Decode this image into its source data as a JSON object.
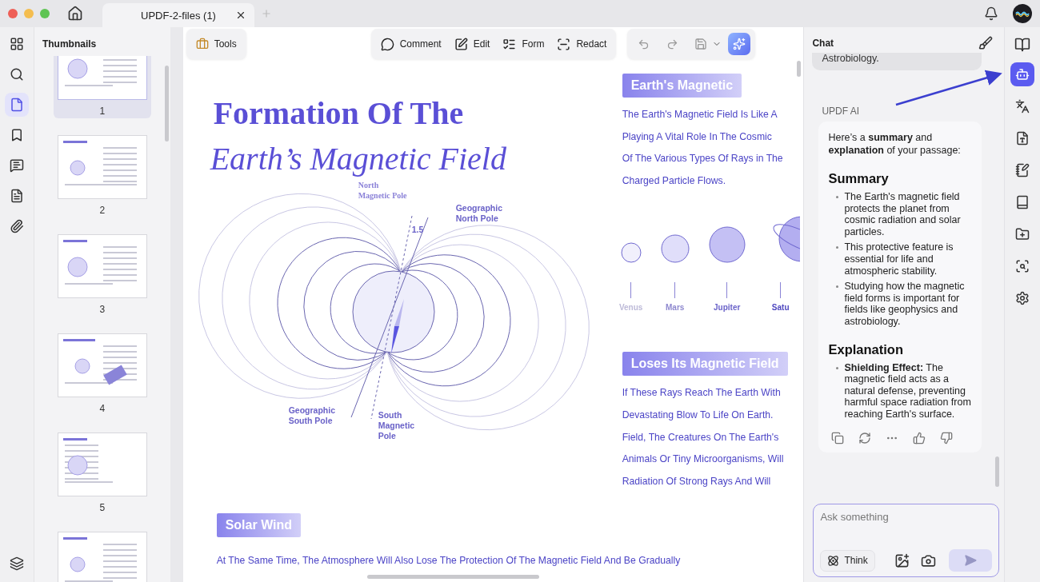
{
  "window": {
    "tab_title": "UPDF-2-files (1)"
  },
  "left_rail": [
    {
      "kind": "grid",
      "selected": false
    },
    {
      "kind": "search",
      "selected": false
    },
    {
      "kind": "page",
      "selected": true
    },
    {
      "kind": "bookmark",
      "selected": false
    },
    {
      "kind": "comment",
      "selected": false
    },
    {
      "kind": "form",
      "selected": false
    },
    {
      "kind": "attachment",
      "selected": false
    },
    {
      "kind": "layers",
      "selected": false
    }
  ],
  "thumbnails": {
    "title": "Thumbnails",
    "pages": [
      {
        "label": "1",
        "selected": true
      },
      {
        "label": "2",
        "selected": false
      },
      {
        "label": "3",
        "selected": false
      },
      {
        "label": "4",
        "selected": false
      },
      {
        "label": "5",
        "selected": false
      },
      {
        "selected": false
      }
    ]
  },
  "toolbar": {
    "tools": "Tools",
    "items": [
      {
        "kind": "comment",
        "label": "Comment"
      },
      {
        "kind": "edit",
        "label": "Edit"
      },
      {
        "kind": "form",
        "label": "Form"
      },
      {
        "kind": "redact",
        "label": "Redact"
      }
    ]
  },
  "document": {
    "title": [
      "Formation Of The",
      "Earth’s Magnetic Field"
    ],
    "diagram_labels": [
      [
        "North",
        "Magnetic Pole"
      ],
      [
        "Geographic",
        "North Pole"
      ],
      [
        "1.5"
      ],
      [
        "Geographic",
        "South Pole"
      ],
      [
        "South",
        "Magnetic",
        "Pole"
      ]
    ],
    "sections": [
      {
        "heading": "Earth's Magnetic",
        "lines": [
          "The Earth's Magnetic Field Is Like A",
          "Playing A Vital Role In The Cosmic",
          "Of The Various Types Of Rays in The",
          "Charged Particle Flows."
        ]
      },
      {
        "heading": "Loses Its Magnetic Field",
        "lines": [
          "If These Rays Reach The Earth With",
          "Devastating Blow To Life On Earth.",
          "Field, The Creatures On The Earth's",
          "Animals Or Tiny Microorganisms, Will",
          "Radiation Of Strong Rays And Will"
        ]
      }
    ],
    "planets": [
      {
        "label": "Venus",
        "color": "#f1f0fc"
      },
      {
        "label": "Mars",
        "color": "#e0defa"
      },
      {
        "label": "Jupiter",
        "color": "#c4c0f4"
      },
      {
        "label": "Satu",
        "color": "#b3aef0"
      }
    ],
    "solar_heading": "Solar Wind",
    "solar_line": "At The Same Time, The Atmosphere Will Also Lose The Protection Of The Magnetic Field And Be Gradually"
  },
  "chat": {
    "title": "Chat",
    "previous": "Astrobiology.",
    "sender": "UPDF AI",
    "intro": "Here’s a **summary** and **explanation** of your passage:",
    "sections": [
      {
        "heading": "Summary",
        "bullets": [
          "The Earth's magnetic field protects the planet from cosmic radiation and solar particles.",
          "This protective feature is essential for life and atmospheric stability.",
          "Studying how the magnetic field forms is important for fields like geophysics and astrobiology."
        ]
      },
      {
        "heading": "Explanation",
        "bullets": [
          "**Shielding Effect:** The magnetic field acts as a natural defense, preventing harmful space radiation from reaching Earth's surface."
        ]
      }
    ],
    "placeholder": "Ask something",
    "think": "Think",
    "send_enabled": false
  },
  "right_rail": [
    {
      "kind": "ai-chat",
      "selected": true
    },
    {
      "kind": "translate",
      "selected": false
    },
    {
      "kind": "translate-box",
      "selected": false
    },
    {
      "kind": "notes",
      "selected": false
    },
    {
      "kind": "book",
      "selected": false
    },
    {
      "kind": "folder",
      "selected": false
    },
    {
      "kind": "search",
      "selected": false
    },
    {
      "kind": "settings",
      "selected": false
    }
  ]
}
